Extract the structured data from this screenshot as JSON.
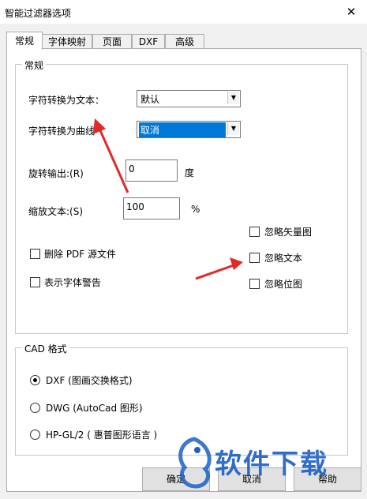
{
  "window": {
    "title": "智能过滤器选项",
    "close_glyph": "✕"
  },
  "tabs": [
    {
      "label": "常规",
      "active": true
    },
    {
      "label": "字体映射"
    },
    {
      "label": "页面"
    },
    {
      "label": "DXF"
    },
    {
      "label": "高级"
    }
  ],
  "general": {
    "group_title": "常规",
    "text_convert_label": "字符转换为文本：",
    "text_convert_value": "默认",
    "curve_convert_label": "字符转换为曲线",
    "curve_convert_value": "取消",
    "rotation_label": "旋转输出:(R)",
    "rotation_value": "0",
    "rotation_unit": "度",
    "scale_label": "缩放文本:(S)",
    "scale_value": "100",
    "scale_unit": "%",
    "delete_pdf_label": "删除 PDF 源文件",
    "show_font_warning_label": "表示字体警告",
    "ignore_vector_label": "忽略矢量图",
    "ignore_text_label": "忽略文本",
    "ignore_bitmap_label": "忽略位图"
  },
  "cad": {
    "group_title": "CAD 格式",
    "options": [
      {
        "label": "DXF (图画交换格式)",
        "selected": true
      },
      {
        "label": "DWG (AutoCad 图形)",
        "selected": false
      },
      {
        "label": "HP-GL/2 ( 惠普图形语言 )",
        "selected": false
      }
    ]
  },
  "buttons": {
    "ok": "确定",
    "cancel": "取消",
    "help": "帮助"
  },
  "watermark": {
    "text": "软件下载",
    "icon": "dragon-logo-icon"
  },
  "colors": {
    "arrow": "#e02a2a",
    "selection": "#0078d7",
    "watermark": "#1b5fc6"
  }
}
